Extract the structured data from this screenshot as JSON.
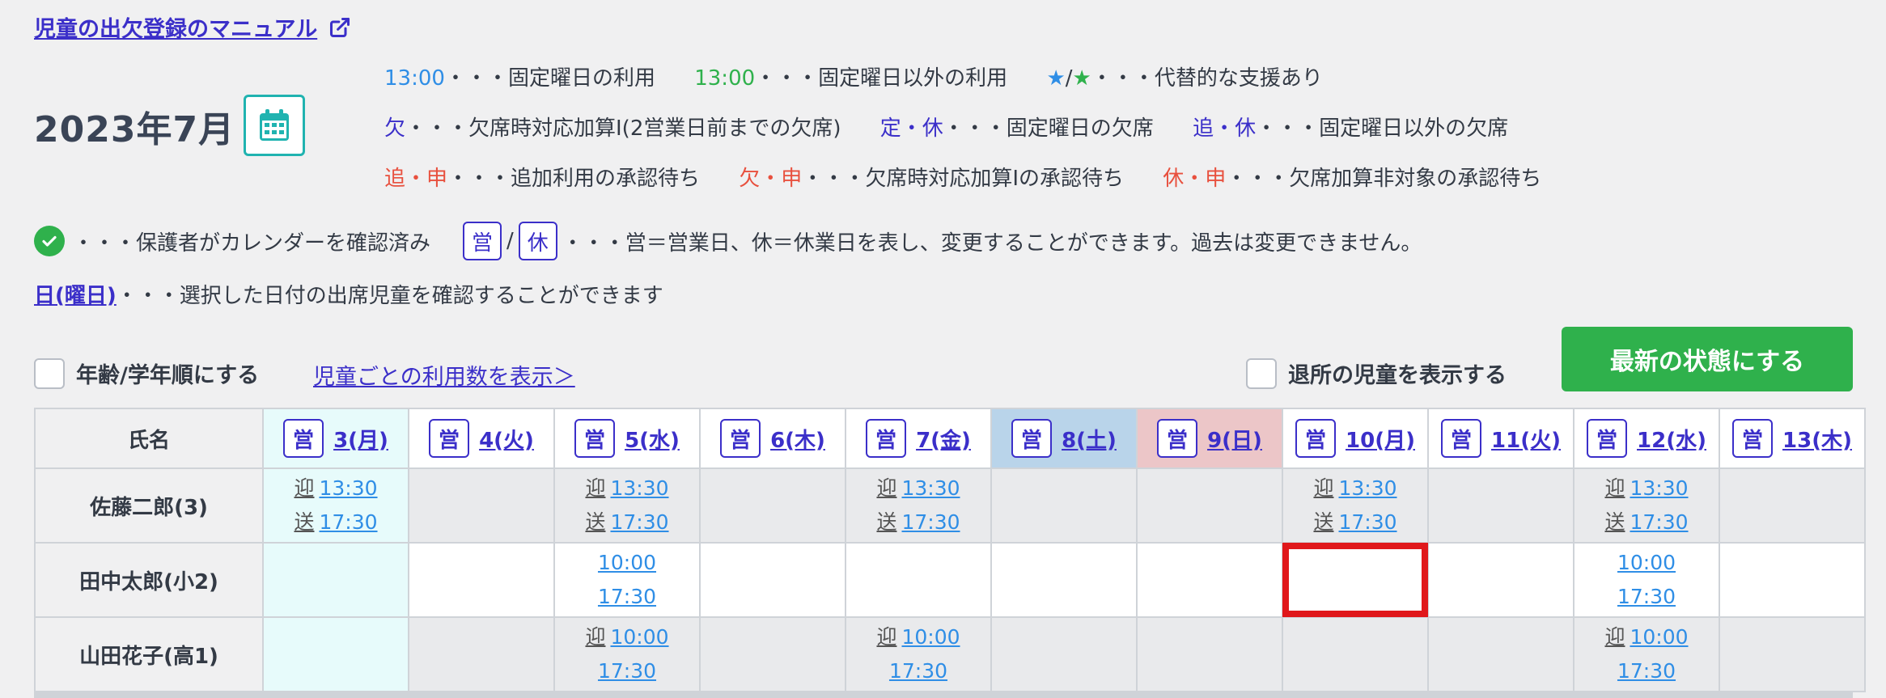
{
  "manual_link": "児童の出欠登録のマニュアル",
  "month": "2023年7月",
  "legend": {
    "fixed_time": "13:00",
    "fixed_text": "・・・固定曜日の利用",
    "other_time": "13:00",
    "other_text": "・・・固定曜日以外の利用",
    "star_blue": "★",
    "star_slash": "/",
    "star_green": "★",
    "star_text": "・・・代替的な支援あり",
    "absent": "欠",
    "absent_text": "・・・欠席時対応加算Ⅰ(2営業日前までの欠席)",
    "fixed_off": "定・休",
    "fixed_off_text": "・・・固定曜日の欠席",
    "extra_off": "追・休",
    "extra_off_text": "・・・固定曜日以外の欠席",
    "req_add": "追・申",
    "req_add_text": "・・・追加利用の承認待ち",
    "req_absent": "欠・申",
    "req_absent_text": "・・・欠席時対応加算Ⅰの承認待ち",
    "req_off": "休・申",
    "req_off_text": "・・・欠席加算非対象の承認待ち",
    "confirmed_text": "・・・保護者がカレンダーを確認済み",
    "open_label": "営",
    "slash": "/",
    "closed_label": "休",
    "open_closed_text": "・・・営＝営業日、休＝休業日を表し、変更することができます。過去は変更できません。",
    "day_link": "日(曜日)",
    "day_text": "・・・選択した日付の出席児童を確認することができます"
  },
  "controls": {
    "age_sort_label": "年齢/学年順にする",
    "usage_link": "児童ごとの利用数を表示＞",
    "show_left_label": "退所の児童を表示する",
    "refresh_button": "最新の状態にする"
  },
  "table": {
    "name_header": "氏名",
    "days": [
      {
        "status": "営",
        "label": "3(月)"
      },
      {
        "status": "営",
        "label": "4(火)"
      },
      {
        "status": "営",
        "label": "5(水)"
      },
      {
        "status": "営",
        "label": "6(木)"
      },
      {
        "status": "営",
        "label": "7(金)"
      },
      {
        "status": "営",
        "label": "8(土)"
      },
      {
        "status": "営",
        "label": "9(日)"
      },
      {
        "status": "営",
        "label": "10(月)"
      },
      {
        "status": "営",
        "label": "11(火)"
      },
      {
        "status": "営",
        "label": "12(水)"
      },
      {
        "status": "営",
        "label": "13(木)"
      }
    ],
    "rows": [
      {
        "name": "佐藤二郎(3)",
        "cells": [
          {
            "t1tag": "迎",
            "t1": "13:30",
            "t2tag": "送",
            "t2": "17:30"
          },
          {},
          {
            "t1tag": "迎",
            "t1": "13:30",
            "t2tag": "送",
            "t2": "17:30"
          },
          {},
          {
            "t1tag": "迎",
            "t1": "13:30",
            "t2tag": "送",
            "t2": "17:30"
          },
          {},
          {},
          {
            "t1tag": "迎",
            "t1": "13:30",
            "t2tag": "送",
            "t2": "17:30"
          },
          {},
          {
            "t1tag": "迎",
            "t1": "13:30",
            "t2tag": "送",
            "t2": "17:30"
          },
          {}
        ]
      },
      {
        "name": "田中太郎(小2)",
        "cells": [
          {},
          {},
          {
            "t1": "10:00",
            "t2": "17:30"
          },
          {},
          {},
          {},
          {},
          {},
          {},
          {
            "t1": "10:00",
            "t2": "17:30"
          },
          {}
        ]
      },
      {
        "name": "山田花子(高1)",
        "cells": [
          {},
          {},
          {
            "t1tag": "迎",
            "t1": "10:00",
            "t2": "17:30"
          },
          {},
          {
            "t1tag": "迎",
            "t1": "10:00",
            "t2": "17:30"
          },
          {},
          {},
          {},
          {},
          {
            "t1tag": "迎",
            "t1": "10:00",
            "t2": "17:30"
          },
          {}
        ]
      }
    ]
  }
}
